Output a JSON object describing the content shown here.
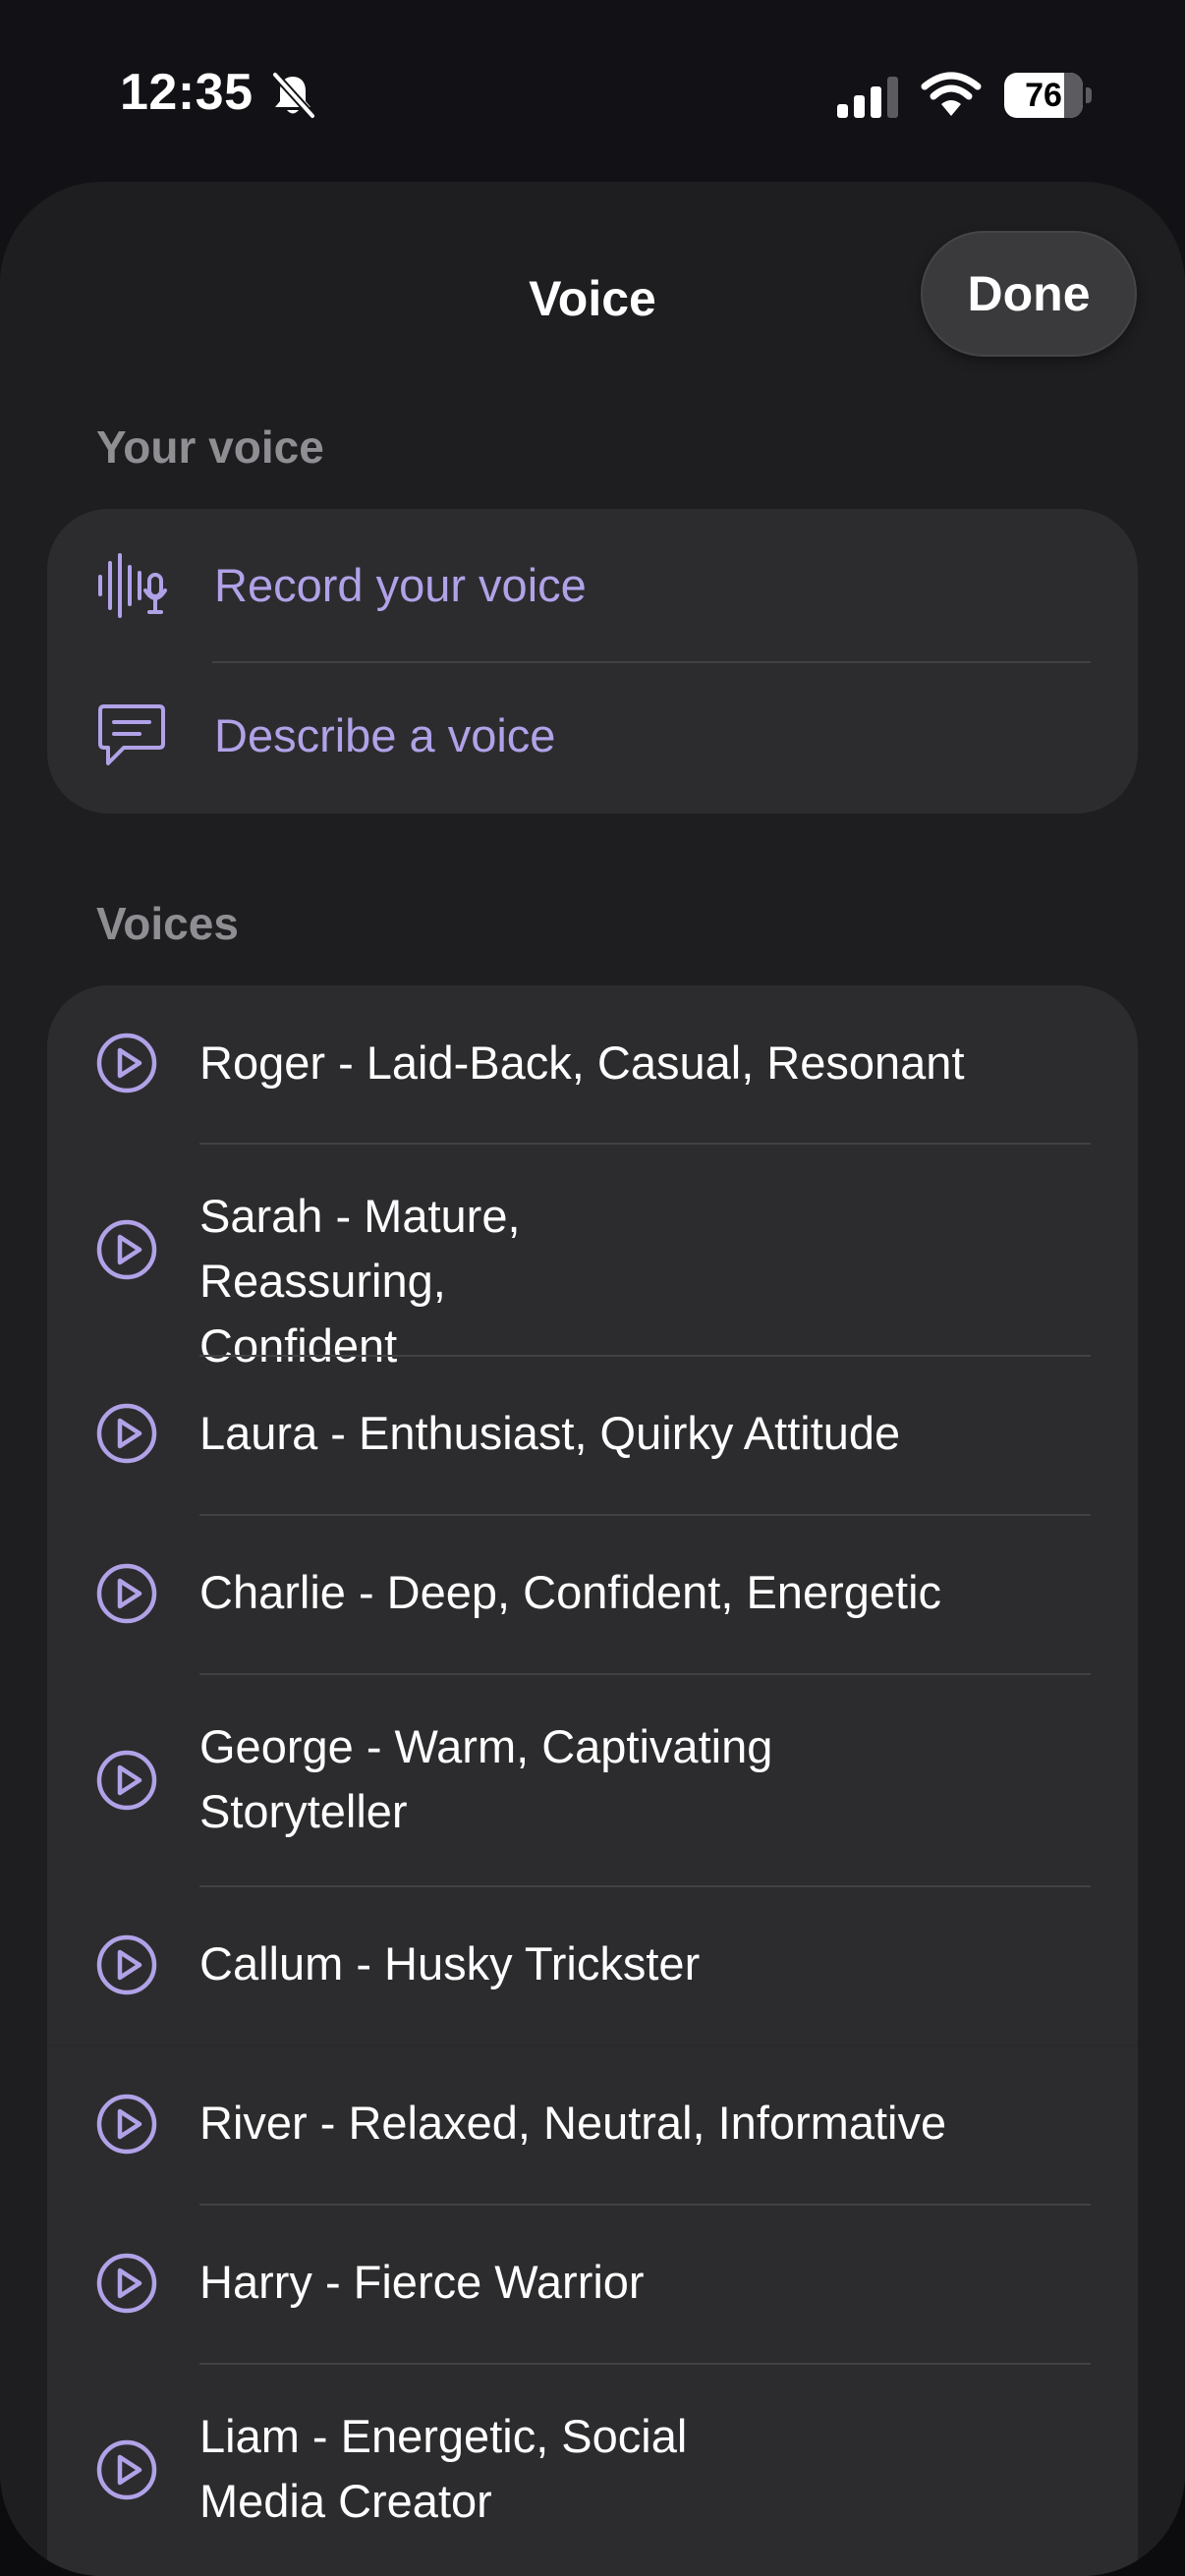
{
  "status_bar": {
    "time": "12:35",
    "battery_percent": "76",
    "battery_level": 0.76
  },
  "sheet": {
    "title": "Voice",
    "done_label": "Done"
  },
  "your_voice": {
    "header": "Your voice",
    "items": [
      {
        "label": "Record your voice",
        "icon": "waveform-mic-icon"
      },
      {
        "label": "Describe a voice",
        "icon": "speech-bubble-icon"
      }
    ]
  },
  "voices": {
    "header": "Voices",
    "items": [
      {
        "label": "Roger - Laid-Back, Casual, Resonant"
      },
      {
        "label": "Sarah - Mature, Reassuring, Confident"
      },
      {
        "label": "Laura - Enthusiast, Quirky Attitude"
      },
      {
        "label": "Charlie - Deep, Confident, Energetic"
      },
      {
        "label": "George - Warm, Captivating Storyteller"
      },
      {
        "label": "Callum - Husky Trickster"
      },
      {
        "label": "River - Relaxed, Neutral, Informative"
      },
      {
        "label": "Harry - Fierce Warrior"
      },
      {
        "label": "Liam - Energetic, Social Media Creator"
      }
    ]
  },
  "colors": {
    "accent": "#b1a2e8",
    "sheet_background": "#1e1e20",
    "group_background": "#2c2c2e"
  }
}
